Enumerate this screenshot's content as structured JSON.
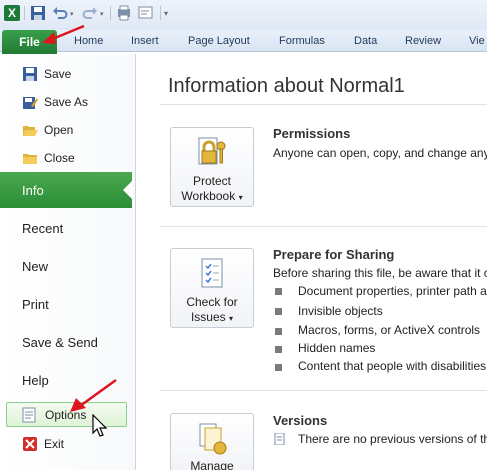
{
  "qat": {
    "logo_letter": "X",
    "icons": [
      "save-icon",
      "undo-icon",
      "redo-icon",
      "print-preview-icon",
      "customize-icon"
    ]
  },
  "ribbon": {
    "file_tab": "File",
    "tabs": [
      "Home",
      "Insert",
      "Page Layout",
      "Formulas",
      "Data",
      "Review",
      "Vie"
    ]
  },
  "nav": {
    "save": "Save",
    "save_as": "Save As",
    "open": "Open",
    "close": "Close",
    "info": "Info",
    "recent": "Recent",
    "new": "New",
    "print": "Print",
    "save_send": "Save & Send",
    "help": "Help",
    "options": "Options",
    "exit": "Exit"
  },
  "main": {
    "title": "Information about Normal1",
    "permissions": {
      "button_line1": "Protect",
      "button_line2": "Workbook",
      "title": "Permissions",
      "text": "Anyone can open, copy, and change any"
    },
    "sharing": {
      "button_line1": "Check for",
      "button_line2": "Issues",
      "title": "Prepare for Sharing",
      "text": "Before sharing this file, be aware that it c",
      "items": [
        "Document properties, printer path a",
        "Invisible objects",
        "Macros, forms, or ActiveX controls",
        "Hidden names",
        "Content that people with disabilities"
      ]
    },
    "versions": {
      "button_line1": "Manage",
      "title": "Versions",
      "text": "There are no previous versions of th"
    }
  },
  "colors": {
    "file_green": "#217a32",
    "info_green": "#2c8d37",
    "arrow_red": "#e0141e"
  }
}
